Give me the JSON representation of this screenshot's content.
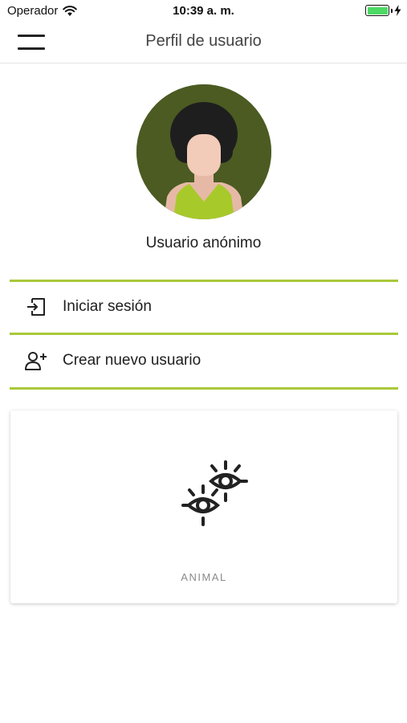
{
  "status_bar": {
    "carrier": "Operador",
    "time": "10:39 a. m.",
    "icons": {
      "wifi": "wifi-icon",
      "battery": "battery-icon",
      "charging": "bolt-icon"
    },
    "battery_level": 1.0,
    "battery_color": "#4cd964"
  },
  "nav": {
    "title": "Perfil de usuario",
    "menu_icon": "hamburger-menu-icon"
  },
  "profile": {
    "name": "Usuario anónimo",
    "avatar_bg": "#4b5b22"
  },
  "menu": [
    {
      "label": "Iniciar sesión",
      "icon": "login-icon"
    },
    {
      "label": "Crear nuevo usuario",
      "icon": "add-user-icon"
    }
  ],
  "colors": {
    "accent": "#a9c83a",
    "text": "#1e1e1e",
    "muted": "#8a8a8a"
  },
  "card": {
    "label": "ANIMAL",
    "icon": "animal-eyes-icon"
  }
}
